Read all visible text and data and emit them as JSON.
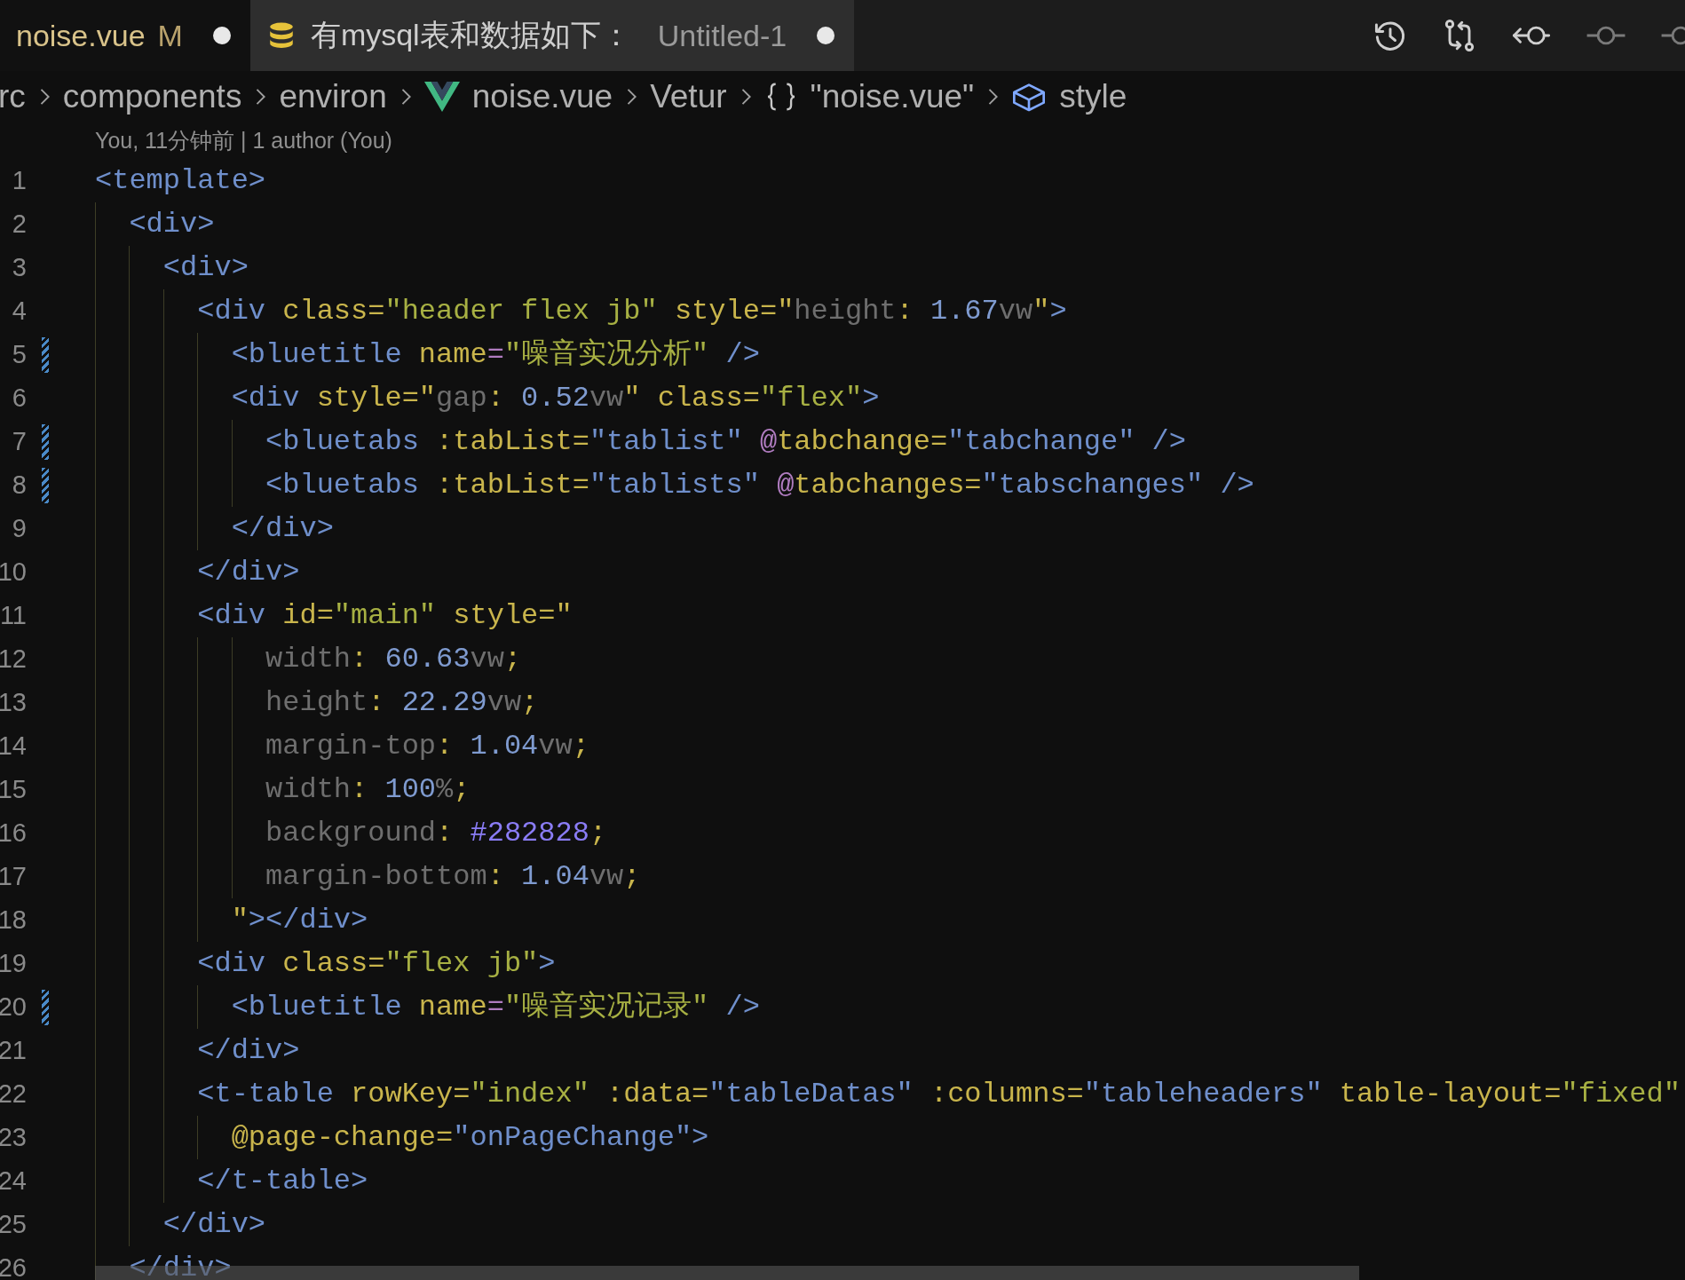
{
  "tabs": [
    {
      "kind": "file",
      "label": "noise.vue",
      "git_status": "M",
      "dirty": true,
      "selected": true
    },
    {
      "kind": "database",
      "label": "有mysql表和数据如下：",
      "description": "Untitled-1",
      "dirty": true,
      "selected": false
    }
  ],
  "breadcrumb": [
    {
      "label": "rc"
    },
    {
      "label": "components"
    },
    {
      "label": "environ"
    },
    {
      "label": "noise.vue",
      "kind": "vue"
    },
    {
      "label": "Vetur"
    },
    {
      "label": "\"noise.vue\"",
      "kind": "object"
    },
    {
      "label": "style",
      "kind": "style"
    }
  ],
  "blame": "You, 11分钟前 | 1 author (You)",
  "lines": [
    {
      "number": "1",
      "modified": false,
      "tokens": [
        {
          "kind": "tag",
          "text": "<template>"
        }
      ]
    },
    {
      "number": "2",
      "modified": false,
      "tokens": [
        {
          "kind": "tag",
          "text": "  <div>"
        }
      ]
    },
    {
      "number": "3",
      "modified": false,
      "tokens": [
        {
          "kind": "tag",
          "text": "    <div>"
        }
      ]
    },
    {
      "number": "4",
      "modified": false,
      "tokens": [
        {
          "kind": "tag",
          "text": "      <div"
        },
        {
          "kind": "attr",
          "text": " class="
        },
        {
          "kind": "string",
          "text": "\"header flex jb\""
        },
        {
          "kind": "attr",
          "text": " style=\""
        },
        {
          "kind": "prop",
          "text": "height"
        },
        {
          "kind": "punct",
          "text": ":"
        },
        {
          "kind": "number",
          "text": " 1.67"
        },
        {
          "kind": "unit",
          "text": "vw"
        },
        {
          "kind": "attr",
          "text": "\""
        },
        {
          "kind": "tag",
          "text": ">"
        }
      ]
    },
    {
      "number": "5",
      "modified": true,
      "tokens": [
        {
          "kind": "tag",
          "text": "        <bluetitle"
        },
        {
          "kind": "attr",
          "text": " name"
        },
        {
          "kind": "event",
          "text": "="
        },
        {
          "kind": "string",
          "text": "\"噪音实况分析\""
        },
        {
          "kind": "tag",
          "text": " />"
        }
      ]
    },
    {
      "number": "6",
      "modified": false,
      "tokens": [
        {
          "kind": "tag",
          "text": "        <div"
        },
        {
          "kind": "attr",
          "text": " style=\""
        },
        {
          "kind": "prop",
          "text": "gap"
        },
        {
          "kind": "punct",
          "text": ":"
        },
        {
          "kind": "number",
          "text": " 0.52"
        },
        {
          "kind": "unit",
          "text": "vw"
        },
        {
          "kind": "attr",
          "text": "\" class="
        },
        {
          "kind": "string",
          "text": "\"flex\""
        },
        {
          "kind": "tag",
          "text": ">"
        }
      ]
    },
    {
      "number": "7",
      "modified": true,
      "tokens": [
        {
          "kind": "tag",
          "text": "          <bluetabs"
        },
        {
          "kind": "attr",
          "text": " :tabList="
        },
        {
          "kind": "bound",
          "text": "\"tablist\""
        },
        {
          "kind": "event",
          "text": " @"
        },
        {
          "kind": "attr",
          "text": "tabchange="
        },
        {
          "kind": "bound",
          "text": "\"tabchange\""
        },
        {
          "kind": "tag",
          "text": " />"
        }
      ]
    },
    {
      "number": "8",
      "modified": true,
      "tokens": [
        {
          "kind": "tag",
          "text": "          <bluetabs"
        },
        {
          "kind": "attr",
          "text": " :tabList="
        },
        {
          "kind": "bound",
          "text": "\"tablists\""
        },
        {
          "kind": "event",
          "text": " @"
        },
        {
          "kind": "attr",
          "text": "tabchanges="
        },
        {
          "kind": "bound",
          "text": "\"tabschanges\""
        },
        {
          "kind": "tag",
          "text": " />"
        }
      ]
    },
    {
      "number": "9",
      "modified": false,
      "tokens": [
        {
          "kind": "tag",
          "text": "        </div>"
        }
      ]
    },
    {
      "number": "10",
      "modified": false,
      "tokens": [
        {
          "kind": "tag",
          "text": "      </div>"
        }
      ]
    },
    {
      "number": "11",
      "modified": false,
      "tokens": [
        {
          "kind": "tag",
          "text": "      <div"
        },
        {
          "kind": "attr",
          "text": " id="
        },
        {
          "kind": "string",
          "text": "\"main\""
        },
        {
          "kind": "attr",
          "text": " style=\""
        }
      ]
    },
    {
      "number": "12",
      "modified": false,
      "tokens": [
        {
          "kind": "prop",
          "text": "          width"
        },
        {
          "kind": "punct",
          "text": ":"
        },
        {
          "kind": "number",
          "text": " 60.63"
        },
        {
          "kind": "unit",
          "text": "vw"
        },
        {
          "kind": "punct",
          "text": ";"
        }
      ]
    },
    {
      "number": "13",
      "modified": false,
      "tokens": [
        {
          "kind": "prop",
          "text": "          height"
        },
        {
          "kind": "punct",
          "text": ":"
        },
        {
          "kind": "number",
          "text": " 22.29"
        },
        {
          "kind": "unit",
          "text": "vw"
        },
        {
          "kind": "punct",
          "text": ";"
        }
      ]
    },
    {
      "number": "14",
      "modified": false,
      "tokens": [
        {
          "kind": "prop",
          "text": "          margin-top"
        },
        {
          "kind": "punct",
          "text": ":"
        },
        {
          "kind": "number",
          "text": " 1.04"
        },
        {
          "kind": "unit",
          "text": "vw"
        },
        {
          "kind": "punct",
          "text": ";"
        }
      ]
    },
    {
      "number": "15",
      "modified": false,
      "tokens": [
        {
          "kind": "prop",
          "text": "          width"
        },
        {
          "kind": "punct",
          "text": ":"
        },
        {
          "kind": "number",
          "text": " 100"
        },
        {
          "kind": "unit",
          "text": "%"
        },
        {
          "kind": "punct",
          "text": ";"
        }
      ]
    },
    {
      "number": "16",
      "modified": false,
      "tokens": [
        {
          "kind": "prop",
          "text": "          background"
        },
        {
          "kind": "punct",
          "text": ":"
        },
        {
          "kind": "color",
          "text": " #282828"
        },
        {
          "kind": "punct",
          "text": ";"
        }
      ]
    },
    {
      "number": "17",
      "modified": false,
      "tokens": [
        {
          "kind": "prop",
          "text": "          margin-bottom"
        },
        {
          "kind": "punct",
          "text": ":"
        },
        {
          "kind": "number",
          "text": " 1.04"
        },
        {
          "kind": "unit",
          "text": "vw"
        },
        {
          "kind": "punct",
          "text": ";"
        }
      ]
    },
    {
      "number": "18",
      "modified": false,
      "tokens": [
        {
          "kind": "attr",
          "text": "        \""
        },
        {
          "kind": "tag",
          "text": "></div>"
        }
      ]
    },
    {
      "number": "19",
      "modified": false,
      "tokens": [
        {
          "kind": "tag",
          "text": "      <div"
        },
        {
          "kind": "attr",
          "text": " class="
        },
        {
          "kind": "string",
          "text": "\"flex jb\""
        },
        {
          "kind": "tag",
          "text": ">"
        }
      ]
    },
    {
      "number": "20",
      "modified": true,
      "tokens": [
        {
          "kind": "tag",
          "text": "        <bluetitle"
        },
        {
          "kind": "attr",
          "text": " name"
        },
        {
          "kind": "event",
          "text": "="
        },
        {
          "kind": "string",
          "text": "\"噪音实况记录\""
        },
        {
          "kind": "tag",
          "text": " />"
        }
      ]
    },
    {
      "number": "21",
      "modified": false,
      "tokens": [
        {
          "kind": "tag",
          "text": "      </div>"
        }
      ]
    },
    {
      "number": "22",
      "modified": false,
      "tokens": [
        {
          "kind": "tag",
          "text": "      <t-table"
        },
        {
          "kind": "attr",
          "text": " rowKey="
        },
        {
          "kind": "string",
          "text": "\"index\""
        },
        {
          "kind": "attr",
          "text": " :data="
        },
        {
          "kind": "bound",
          "text": "\"tableDatas\""
        },
        {
          "kind": "attr",
          "text": " :columns="
        },
        {
          "kind": "bound",
          "text": "\"tableheaders\""
        },
        {
          "kind": "attr",
          "text": " table-layout="
        },
        {
          "kind": "string",
          "text": "\"fixed\""
        }
      ]
    },
    {
      "number": "23",
      "modified": false,
      "tokens": [
        {
          "kind": "attr",
          "text": "        @page-change="
        },
        {
          "kind": "bound",
          "text": "\"onPageChange\""
        },
        {
          "kind": "tag",
          "text": ">"
        }
      ]
    },
    {
      "number": "24",
      "modified": false,
      "tokens": [
        {
          "kind": "tag",
          "text": "      </t-table>"
        }
      ]
    },
    {
      "number": "25",
      "modified": false,
      "tokens": [
        {
          "kind": "tag",
          "text": "    </div>"
        }
      ]
    },
    {
      "number": "26",
      "modified": false,
      "tokens": [
        {
          "kind": "tag",
          "text": "  </div>"
        }
      ]
    }
  ]
}
